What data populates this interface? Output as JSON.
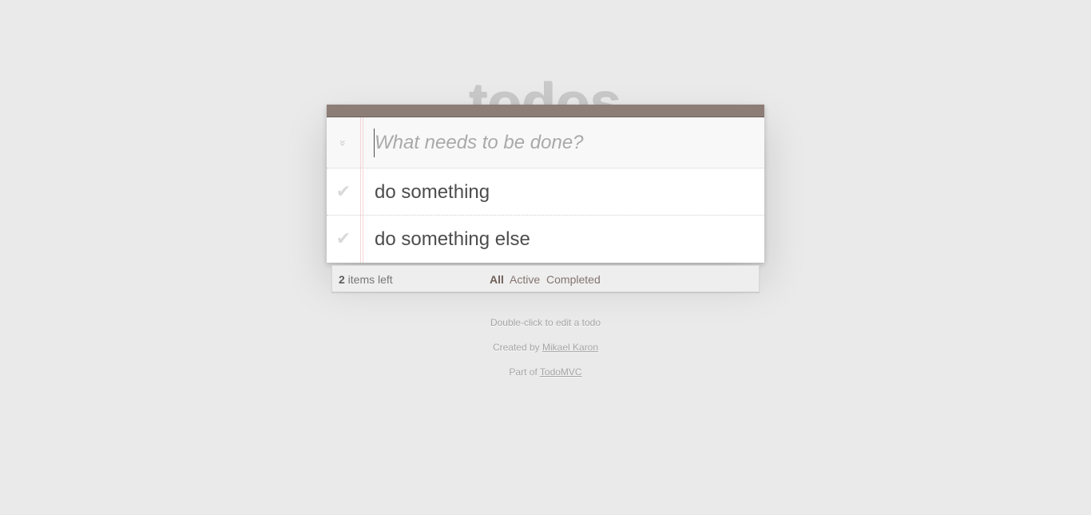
{
  "header": {
    "title": "todos"
  },
  "new_todo": {
    "placeholder": "What needs to be done?",
    "value": ""
  },
  "toggle_all_glyph": "»",
  "todos": [
    {
      "label": "do something",
      "completed": false
    },
    {
      "label": "do something else",
      "completed": false
    }
  ],
  "footer": {
    "count": "2",
    "count_suffix": " items left",
    "filters": [
      "All",
      "Active",
      "Completed"
    ],
    "selected_filter": "All"
  },
  "info": {
    "edit_hint": "Double-click to edit a todo",
    "created_prefix": "Created by ",
    "author": "Mikael Karon",
    "part_prefix": "Part of ",
    "project": "TodoMVC"
  },
  "colors": {
    "background": "#eaeaea",
    "bar": "#8d7d77",
    "title": "#c9c9c9"
  }
}
